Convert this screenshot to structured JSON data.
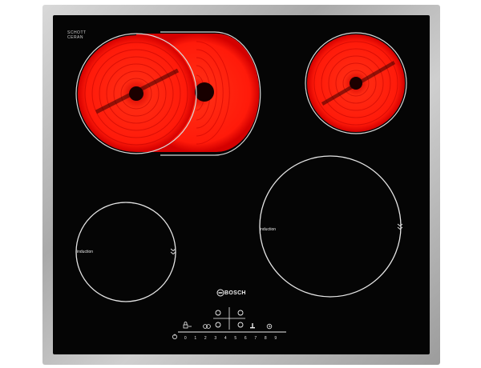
{
  "hob": {
    "glass_brand_line1": "SCHOTT",
    "glass_brand_line2": "CERAN",
    "brand": "BOSCH",
    "zones": [
      {
        "label": "induction"
      },
      {
        "label": "induction"
      }
    ],
    "power_levels": [
      "0",
      "1",
      "2",
      "3",
      "4",
      "5",
      "6",
      "7",
      "8",
      "9"
    ]
  },
  "colors": {
    "glass": "#050505",
    "frame": "#b8b8b8",
    "hot_zone": "#ff1a0a"
  },
  "icons": [
    "lock-icon",
    "dual-zone-icon",
    "timer-icon",
    "power-icon",
    "keep-warm-icon"
  ]
}
